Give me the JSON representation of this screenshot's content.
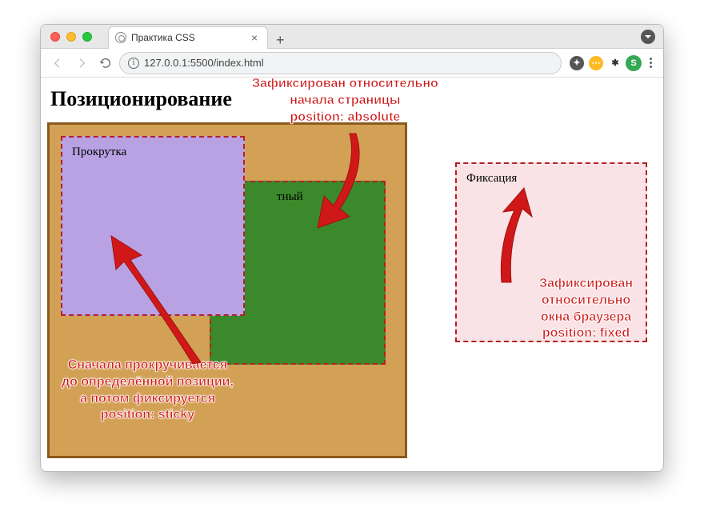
{
  "tab": {
    "title": "Практика CSS"
  },
  "url": "127.0.0.1:5500/index.html",
  "avatar_letter": "S",
  "page": {
    "heading": "Позиционирование",
    "sticky_label": "Прокрутка",
    "absolute_label": "тный",
    "fixed_label": "Фиксация"
  },
  "annotations": {
    "absolute": "Зафиксирован относительно\nначала страницы\nposition: absolute",
    "fixed": "Зафиксирован\nотносительно\nокна браузера\nposition: fixed",
    "sticky": "Сначала прокручивается\nдо определённой позиции,\nа потом фиксируется\nposition: sticky"
  }
}
